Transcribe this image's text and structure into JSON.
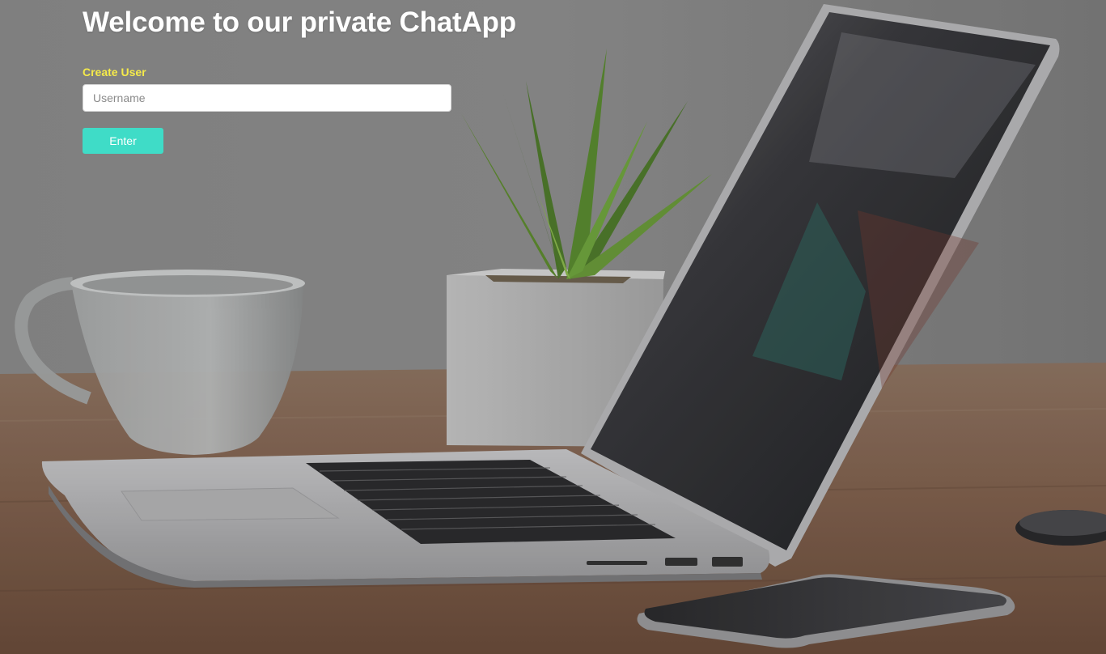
{
  "page": {
    "title": "Welcome to our private ChatApp"
  },
  "form": {
    "label": "Create User",
    "username_placeholder": "Username",
    "username_value": "",
    "submit_label": "Enter"
  },
  "colors": {
    "label": "#f5ea4a",
    "button": "#3fdcc7",
    "title": "#ffffff"
  },
  "background": {
    "description_icon": "desk-photo"
  }
}
